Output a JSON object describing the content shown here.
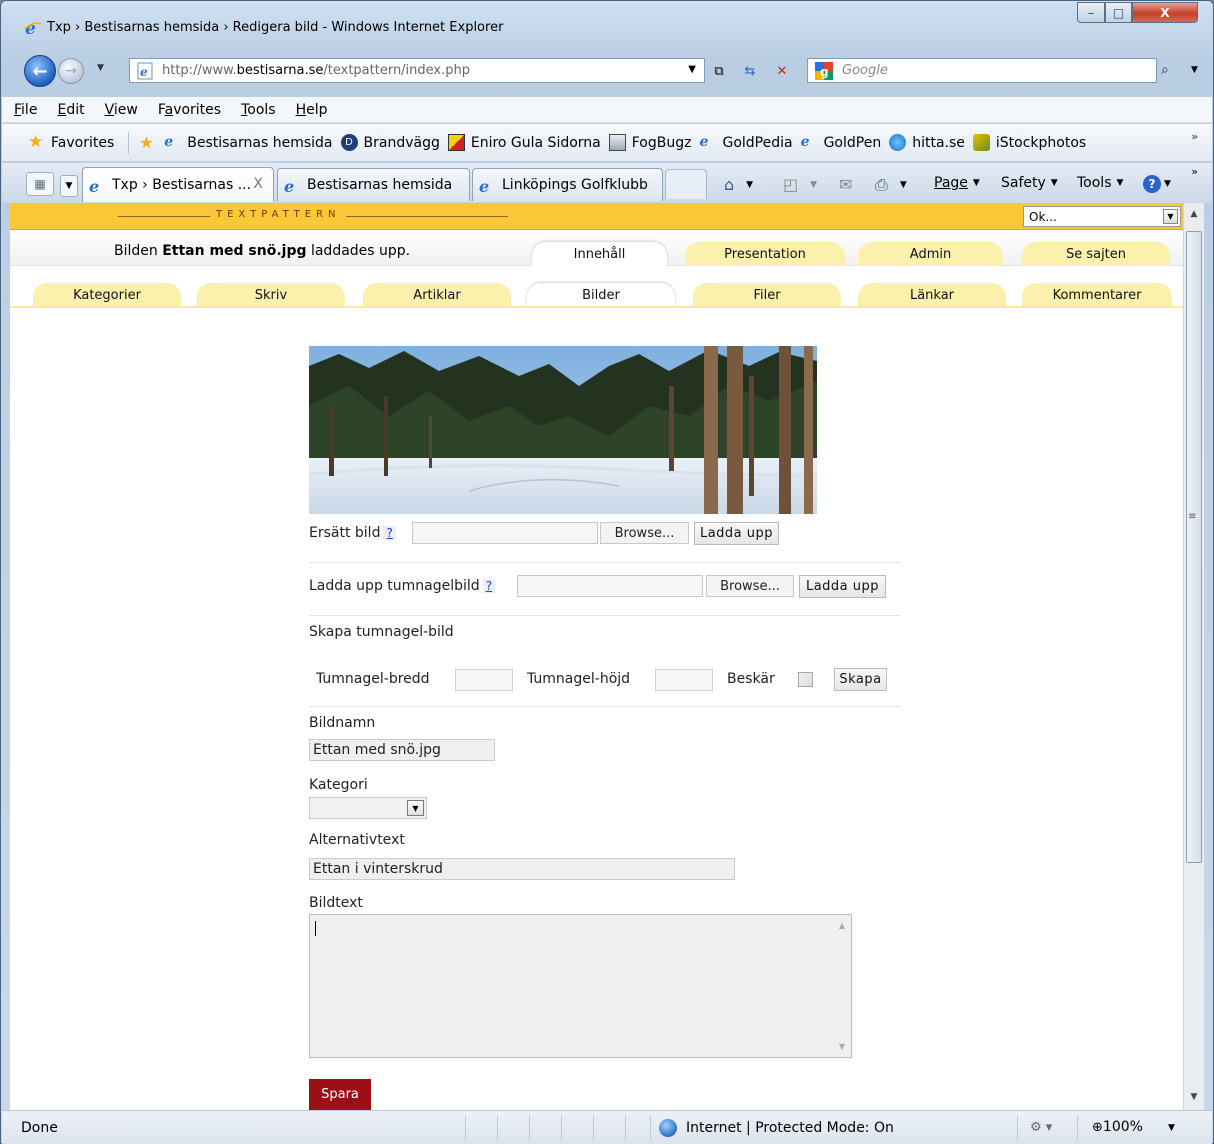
{
  "window": {
    "title": "Txp › Bestisarnas hemsida › Redigera bild - Windows Internet Explorer",
    "controls": {
      "minimize": "–",
      "maximize": "□",
      "close": "X"
    }
  },
  "address_bar": {
    "url_prefix": "http://www.",
    "url_domain": "bestisarna.se",
    "url_suffix": "/textpattern/index.php"
  },
  "search": {
    "placeholder": "Google"
  },
  "menu": [
    {
      "pre": "",
      "u": "F",
      "post": "ile"
    },
    {
      "pre": "",
      "u": "E",
      "post": "dit"
    },
    {
      "pre": "",
      "u": "V",
      "post": "iew"
    },
    {
      "pre": "F",
      "u": "a",
      "post": "vorites"
    },
    {
      "pre": "",
      "u": "T",
      "post": "ools"
    },
    {
      "pre": "",
      "u": "H",
      "post": "elp"
    }
  ],
  "favorites_bar": {
    "favorites_label": "Favorites",
    "items": [
      "Bestisarnas hemsida",
      "Brandvägg",
      "Eniro Gula Sidorna",
      "FogBugz",
      "GoldPedia",
      "GoldPen",
      "hitta.se",
      "iStockphotos"
    ]
  },
  "tabs": [
    {
      "label": "Txp › Bestisarnas ...",
      "close": "X"
    },
    {
      "label": "Bestisarnas hemsida"
    },
    {
      "label": "Linköpings Golfklubb"
    }
  ],
  "command_bar": {
    "page": "Page",
    "safety": "Safety",
    "tools": "Tools"
  },
  "textpattern": {
    "logo": "TEXTPATTERN",
    "jump_value": "Ok...",
    "message_prefix": "Bilden ",
    "message_file": "Ettan med snö.jpg",
    "message_suffix": " laddades upp.",
    "primary_tabs": [
      "Innehåll",
      "Presentation",
      "Admin",
      "Se sajten"
    ],
    "secondary_tabs": [
      "Kategorier",
      "Skriv",
      "Artiklar",
      "Bilder",
      "Filer",
      "Länkar",
      "Kommentarer"
    ]
  },
  "form": {
    "replace_label": "Ersätt bild",
    "help": "?",
    "browse": "Browse...",
    "upload": "Ladda upp",
    "thumb_upload_label": "Ladda upp tumnagelbild",
    "create_thumb_heading": "Skapa tumnagel-bild",
    "thumb_width_label": "Tumnagel-bredd",
    "thumb_height_label": "Tumnagel-höjd",
    "crop_label": "Beskär",
    "create_button": "Skapa",
    "name_label": "Bildnamn",
    "name_value": "Ettan med snö.jpg",
    "category_label": "Kategori",
    "alt_label": "Alternativtext",
    "alt_value": "Ettan i vinterskrud",
    "caption_label": "Bildtext",
    "save_button": "Spara"
  },
  "status_bar": {
    "status": "Done",
    "zone": "Internet | Protected Mode: On",
    "zoom": "100%"
  }
}
